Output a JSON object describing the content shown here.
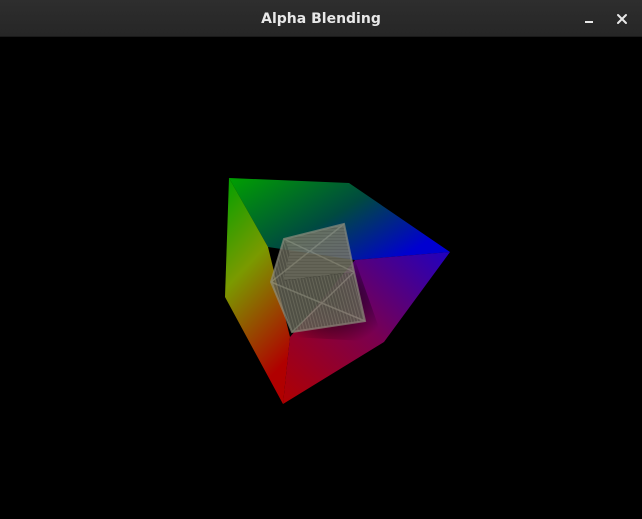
{
  "window": {
    "title": "Alpha Blending"
  },
  "icons": {
    "minimize": "minimize-icon",
    "close": "close-icon"
  },
  "colors": {
    "titlebar_bg": "#2e2e2e",
    "title_text": "#e8e8e8",
    "viewport_bg": "#000000",
    "face_green": "#00a000",
    "face_blue": "#0000c8",
    "face_red": "#a00000",
    "face_magenta": "#b000b0",
    "face_yellow": "#a0a000",
    "crate_wood": "#7a7a6a"
  }
}
